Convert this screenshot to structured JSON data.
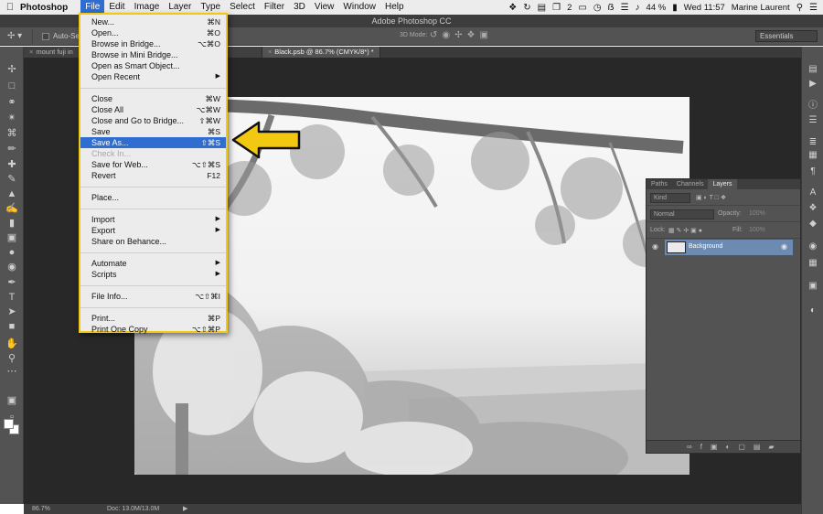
{
  "macbar": {
    "app_name": "Photoshop",
    "menus": [
      "File",
      "Edit",
      "Image",
      "Layer",
      "Type",
      "Select",
      "Filter",
      "3D",
      "View",
      "Window",
      "Help"
    ],
    "badge": "2",
    "battery": "44 %",
    "clock": "Wed 11:57",
    "user": "Marine Laurent"
  },
  "window": {
    "title": "Adobe Photoshop CC"
  },
  "options": {
    "auto_select": "Auto-Selec",
    "mode3d": "3D Mode:",
    "workspace": "Essentials"
  },
  "tabs": [
    {
      "label": "mount fuji in",
      "active": false
    },
    {
      "label": "Black.psb @ 86.7% (CMYK/8*) *",
      "active": true
    }
  ],
  "file_menu": {
    "items": [
      {
        "label": "New...",
        "shortcut": "⌘N"
      },
      {
        "label": "Open...",
        "shortcut": "⌘O"
      },
      {
        "label": "Browse in Bridge...",
        "shortcut": "⌥⌘O"
      },
      {
        "label": "Browse in Mini Bridge...",
        "shortcut": ""
      },
      {
        "label": "Open as Smart Object...",
        "shortcut": ""
      },
      {
        "label": "Open Recent",
        "shortcut": "",
        "submenu": true
      },
      {
        "separator": true
      },
      {
        "label": "Close",
        "shortcut": "⌘W"
      },
      {
        "label": "Close All",
        "shortcut": "⌥⌘W"
      },
      {
        "label": "Close and Go to Bridge...",
        "shortcut": "⇧⌘W"
      },
      {
        "label": "Save",
        "shortcut": "⌘S"
      },
      {
        "label": "Save As...",
        "shortcut": "⇧⌘S",
        "selected": true
      },
      {
        "label": "Check In...",
        "shortcut": "",
        "disabled": true
      },
      {
        "label": "Save for Web...",
        "shortcut": "⌥⇧⌘S"
      },
      {
        "label": "Revert",
        "shortcut": "F12"
      },
      {
        "separator": true
      },
      {
        "label": "Place...",
        "shortcut": ""
      },
      {
        "separator": true
      },
      {
        "label": "Import",
        "shortcut": "",
        "submenu": true
      },
      {
        "label": "Export",
        "shortcut": "",
        "submenu": true
      },
      {
        "label": "Share on Behance...",
        "shortcut": ""
      },
      {
        "separator": true
      },
      {
        "label": "Automate",
        "shortcut": "",
        "submenu": true
      },
      {
        "label": "Scripts",
        "shortcut": "",
        "submenu": true
      },
      {
        "separator": true
      },
      {
        "label": "File Info...",
        "shortcut": "⌥⇧⌘I"
      },
      {
        "separator": true
      },
      {
        "label": "Print...",
        "shortcut": "⌘P"
      },
      {
        "label": "Print One Copy",
        "shortcut": "⌥⇧⌘P"
      }
    ]
  },
  "layers_panel": {
    "tabs": [
      "Paths",
      "Channels",
      "Layers"
    ],
    "active_tab": "Layers",
    "kind": "Kind",
    "blend_mode": "Normal",
    "opacity_label": "Opacity:",
    "opacity_value": "100%",
    "lock_label": "Lock:",
    "fill_label": "Fill:",
    "fill_value": "100%",
    "layer_name": "Background"
  },
  "status": {
    "zoom": "86.7%",
    "doc": "Doc: 13.0M/13.0M"
  },
  "colors": {
    "accent": "#2f6dd0",
    "highlight": "#f2c811",
    "layer_selected": "#6d8bb0"
  }
}
